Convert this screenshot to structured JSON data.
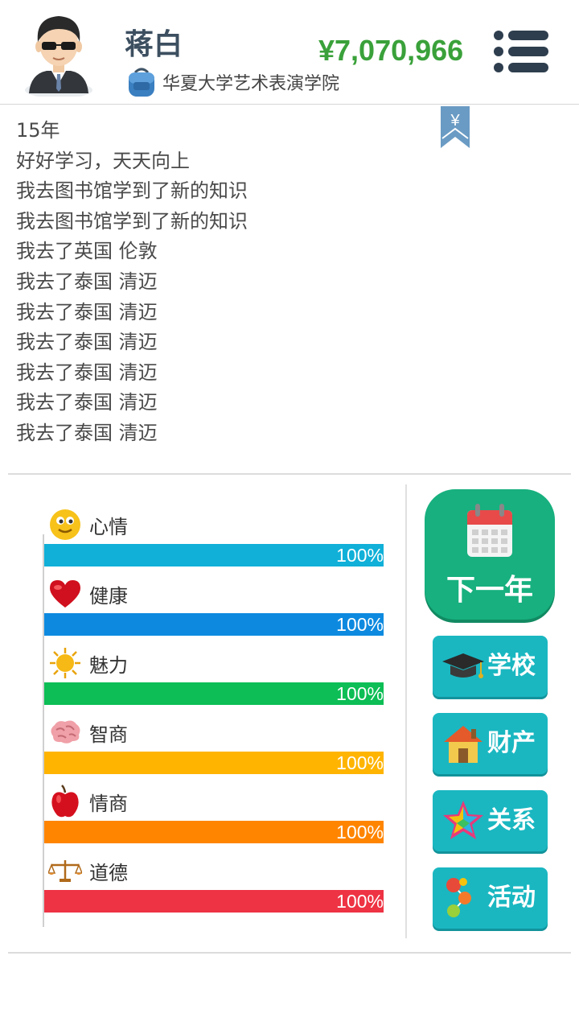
{
  "header": {
    "player_name": "蒋白",
    "money": "¥7,070,966",
    "school_name": "华夏大学艺术表演学院"
  },
  "log": {
    "lines": [
      "15年",
      "好好学习，天天向上",
      "我去图书馆学到了新的知识",
      "我去图书馆学到了新的知识",
      "我去了英国 伦敦",
      "我去了泰国 清迈",
      "我去了泰国 清迈",
      "我去了泰国 清迈",
      "我去了泰国 清迈",
      "我去了泰国 清迈",
      "我去了泰国 清迈"
    ],
    "bookmark_symbol": "¥"
  },
  "stats": [
    {
      "label": "心情",
      "value": "100%",
      "fill": 1.0,
      "color": "#10b0d8",
      "icon": "smiley-icon"
    },
    {
      "label": "健康",
      "value": "100%",
      "fill": 1.0,
      "color": "#0d8ae0",
      "icon": "heart-icon"
    },
    {
      "label": "魅力",
      "value": "100%",
      "fill": 1.0,
      "color": "#0cbe55",
      "icon": "sun-icon"
    },
    {
      "label": "智商",
      "value": "100%",
      "fill": 1.0,
      "color": "#ffb400",
      "icon": "brain-icon"
    },
    {
      "label": "情商",
      "value": "100%",
      "fill": 1.0,
      "color": "#ff8500",
      "icon": "apple-icon"
    },
    {
      "label": "道德",
      "value": "100%",
      "fill": 1.0,
      "color": "#ee3344",
      "icon": "scales-icon"
    }
  ],
  "actions": {
    "next_year": "下一年",
    "school": "学校",
    "property": "财产",
    "relations": "关系",
    "activities": "活动"
  },
  "colors": {
    "money": "#3aa13a",
    "next_year_bg": "#17b07e",
    "side_button_bg": "#1ab7c1"
  }
}
